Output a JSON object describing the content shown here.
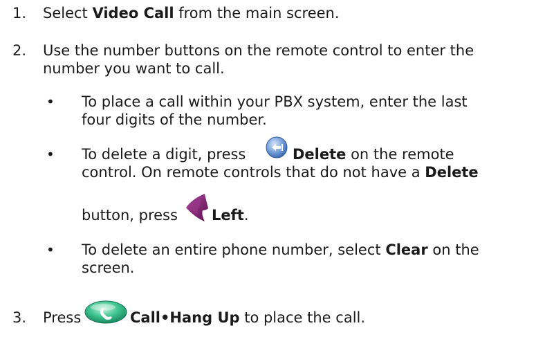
{
  "steps": [
    {
      "number": "1.",
      "pre": "Select ",
      "bold": "Video Call",
      "post": " from the main screen."
    },
    {
      "number": "2.",
      "line1": "Use the number buttons on the remote control to enter the",
      "line2": "number you want to call.",
      "bullets": [
        {
          "line1": "To place a call within your PBX system, enter the last",
          "line2": "four digits of the number."
        },
        {
          "line1_pre": "To delete a digit, press",
          "line1_bold": "Delete",
          "line1_post": " on the remote",
          "line2_pre": "control. On remote controls that do not have a ",
          "line2_bold": "Delete",
          "line3_pre": "button, press",
          "line3_bold": "Left",
          "line3_post": "."
        },
        {
          "line1_pre": "To delete an entire phone number, select ",
          "line1_bold": "Clear",
          "line1_post": " on the",
          "line2": "screen."
        }
      ]
    },
    {
      "number": "3.",
      "pre": "Press",
      "bold": "Call•Hang Up",
      "post": " to place the call."
    }
  ],
  "bullet_glyph": "•",
  "icons": {
    "delete": "delete-button-icon",
    "left": "left-arrow-button-icon",
    "call": "call-hang-up-button-icon"
  },
  "colors": {
    "delete_icon": "#5a86c8",
    "left_icon": "#7a1a6e",
    "call_icon": "#2bb07a"
  }
}
